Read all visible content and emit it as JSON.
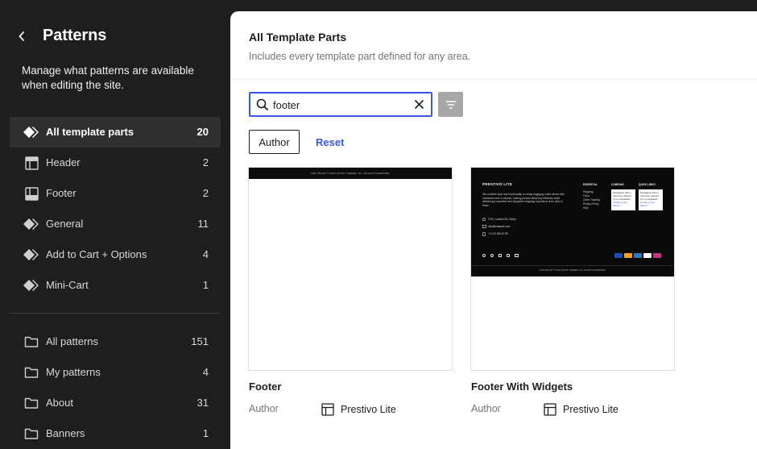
{
  "sidebar": {
    "title": "Patterns",
    "description": "Manage what patterns are available when editing the site.",
    "template_parts": [
      {
        "label": "All template parts",
        "count": "20",
        "icon": "symbol-icon",
        "active": true
      },
      {
        "label": "Header",
        "count": "2",
        "icon": "header-icon"
      },
      {
        "label": "Footer",
        "count": "2",
        "icon": "footer-icon"
      },
      {
        "label": "General",
        "count": "11",
        "icon": "symbol-icon"
      },
      {
        "label": "Add to Cart + Options",
        "count": "4",
        "icon": "symbol-icon"
      },
      {
        "label": "Mini-Cart",
        "count": "1",
        "icon": "symbol-icon"
      }
    ],
    "patterns": [
      {
        "label": "All patterns",
        "count": "151",
        "icon": "folder-icon"
      },
      {
        "label": "My patterns",
        "count": "4",
        "icon": "folder-icon"
      },
      {
        "label": "About",
        "count": "31",
        "icon": "folder-icon"
      },
      {
        "label": "Banners",
        "count": "1",
        "icon": "folder-icon"
      }
    ]
  },
  "main": {
    "title": "All Template Parts",
    "description": "Includes every template part defined for any area.",
    "search": {
      "value": "footer"
    },
    "filters": {
      "author_label": "Author",
      "reset_label": "Reset"
    },
    "cards": [
      {
        "name": "Footer",
        "author_label": "Author",
        "author": "Prestivo Lite",
        "preview": {
          "copyright": "COPYRIGHT © 2025 QUICK THEMEZ. ALL RIGHTS RESERVED."
        }
      },
      {
        "name": "Footer With Widgets",
        "author_label": "Author",
        "author": "Prestivo Lite",
        "preview": {
          "brand": "PRESTIVO LITE",
          "blurb": "We combine style and functionality to create engaging online stores that customers love to explore, making product discovery effortless while delivering a seamless and enjoyable shopping experience from start to finish.",
          "address": "7070, London Rd, Derby",
          "email": "info@example.com",
          "phone": "+1 010 345 67 89",
          "col1_title": "ESSENTIAL",
          "col1_links": [
            "Shipping",
            "FAQs",
            "Order Tracking",
            "Privacy Policy",
            "Help"
          ],
          "col2_title": "COMPANY",
          "col2_text": "Navigation Menu has been deleted or is unavailable.",
          "col2_link": "Create a new Menu?",
          "col3_title": "QUICK LINKS",
          "col3_text": "Navigation Menu has been deleted or is unavailable.",
          "col3_link": "Create a new Menu?",
          "copyright": "COPYRIGHT © 2025 QUICK THEMEZ. ALL RIGHTS RESERVED."
        }
      }
    ]
  }
}
